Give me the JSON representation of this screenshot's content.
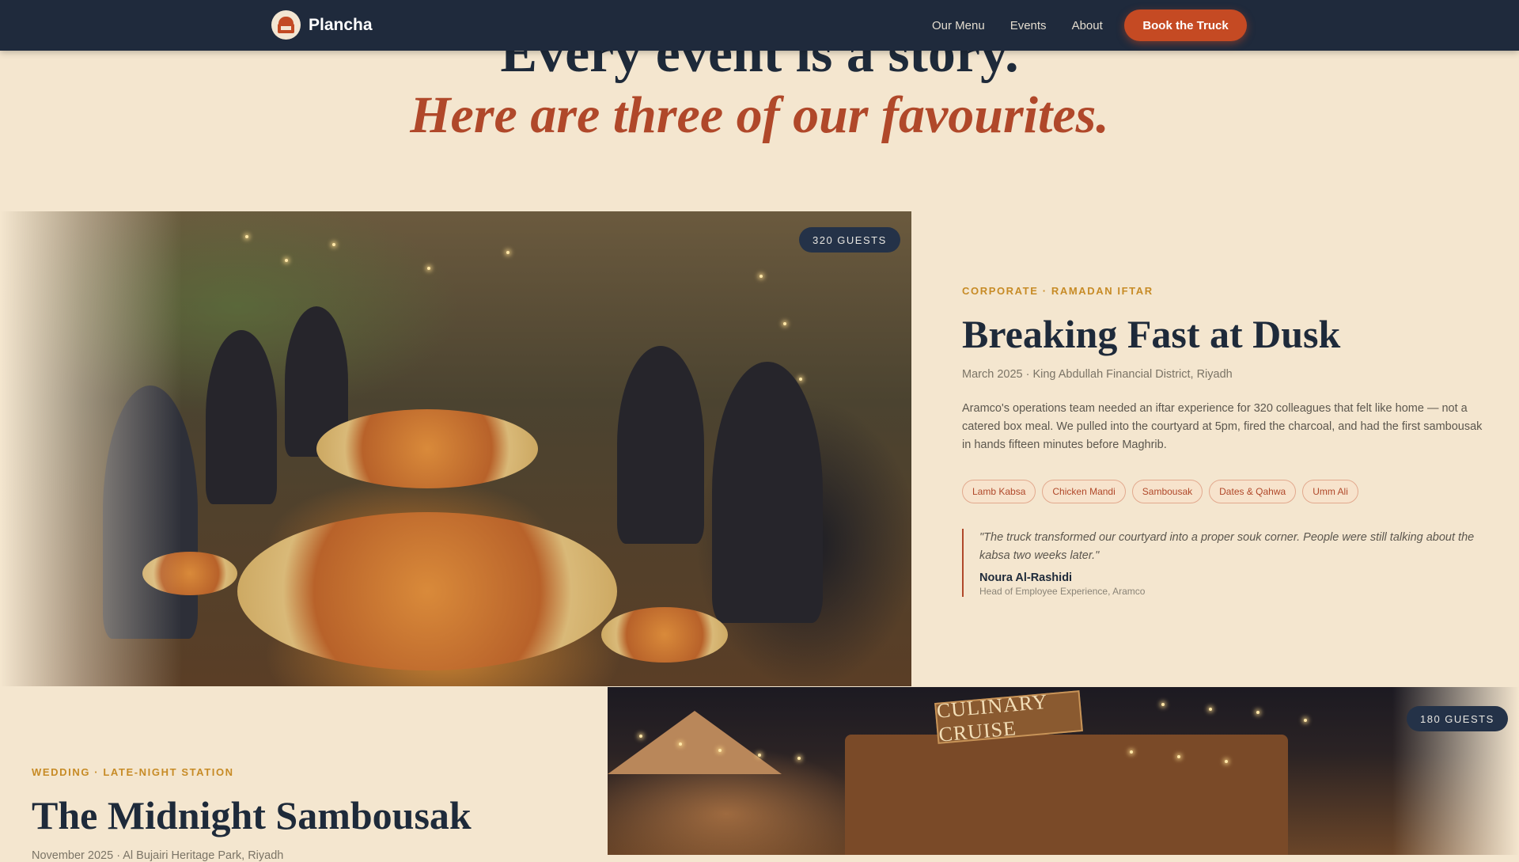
{
  "nav": {
    "brand": "Plancha",
    "links": [
      "Our Menu",
      "Events",
      "About"
    ],
    "cta": "Book the Truck"
  },
  "hero": {
    "title": "Every event is a story.",
    "subtitle": "Here are three of our favourites."
  },
  "stories": [
    {
      "guests": "320 GUESTS",
      "category": "CORPORATE · RAMADAN IFTAR",
      "title": "Breaking Fast at Dusk",
      "meta": "March 2025 · King Abdullah Financial District, Riyadh",
      "description": "Aramco's operations team needed an iftar experience for 320 colleagues that felt like home — not a catered box meal. We pulled into the courtyard at 5pm, fired the charcoal, and had the first sambousak in hands fifteen minutes before Maghrib.",
      "tags": [
        "Lamb Kabsa",
        "Chicken Mandi",
        "Sambousak",
        "Dates & Qahwa",
        "Umm Ali"
      ],
      "quote": "\"The truck transformed our courtyard into a proper souk corner. People were still talking about the kabsa two weeks later.\"",
      "quote_name": "Noura Al-Rashidi",
      "quote_role": "Head of Employee Experience, Aramco"
    },
    {
      "guests": "180 GUESTS",
      "category": "WEDDING · LATE-NIGHT STATION",
      "title": "The Midnight Sambousak",
      "meta": "November 2025 · Al Bujairi Heritage Park, Riyadh",
      "sign": "CULINARY CRUISE"
    }
  ],
  "colors": {
    "background": "#f4e6cf",
    "nav": "#1f2a3c",
    "accent": "#c54a23",
    "category": "#c78b26"
  }
}
